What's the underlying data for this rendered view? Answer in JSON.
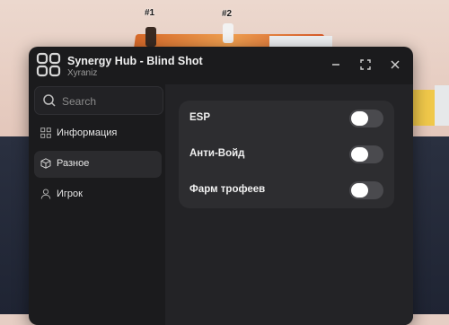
{
  "game": {
    "players": [
      {
        "tag": "#1"
      },
      {
        "tag": "#2"
      }
    ]
  },
  "window": {
    "title": "Synergy Hub - Blind Shot",
    "subtitle": "Xyraniz",
    "controls": [
      "minimize-icon",
      "maximize-icon",
      "close-icon"
    ]
  },
  "sidebar": {
    "search": {
      "placeholder": "Search",
      "value": ""
    },
    "items": [
      {
        "label": "Информация",
        "icon": "info-grid-icon",
        "active": false
      },
      {
        "label": "Разное",
        "icon": "box-icon",
        "active": true
      },
      {
        "label": "Игрок",
        "icon": "user-icon",
        "active": false
      }
    ]
  },
  "content": {
    "toggles": [
      {
        "label": "ESP",
        "on": false
      },
      {
        "label": "Анти-Войд",
        "on": false
      },
      {
        "label": "Фарм трофеев",
        "on": false
      }
    ]
  },
  "colors": {
    "window_bg": "#1b1b1d",
    "content_bg": "#232326",
    "card_bg": "#2d2d30",
    "toggle_off": "#4a4a4e"
  }
}
